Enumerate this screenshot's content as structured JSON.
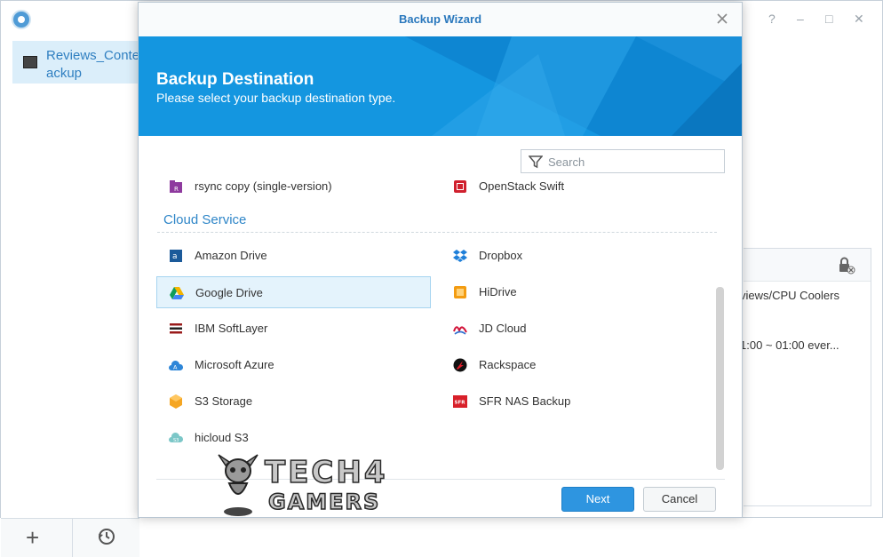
{
  "app": {
    "task_label": "Reviews_Conte\nackup",
    "right_text_1": "views/CPU Coolers",
    "right_text_2": "1:00 ~ 01:00 ever..."
  },
  "modal": {
    "title": "Backup Wizard",
    "heading": "Backup Destination",
    "subheading": "Please select your backup destination type.",
    "search_placeholder": "Search",
    "top_items": [
      {
        "label": "rsync copy (single-version)",
        "icon": "rsync-icon"
      },
      {
        "label": "OpenStack Swift",
        "icon": "openstack-icon"
      }
    ],
    "section_title": "Cloud Service",
    "cloud_left": [
      {
        "label": "Amazon Drive",
        "icon": "amazon-drive-icon"
      },
      {
        "label": "Google Drive",
        "icon": "google-drive-icon",
        "selected": true
      },
      {
        "label": "IBM SoftLayer",
        "icon": "ibm-softlayer-icon"
      },
      {
        "label": "Microsoft Azure",
        "icon": "azure-icon"
      },
      {
        "label": "S3 Storage",
        "icon": "s3-storage-icon"
      },
      {
        "label": "hicloud S3",
        "icon": "hicloud-icon"
      }
    ],
    "cloud_right": [
      {
        "label": "Dropbox",
        "icon": "dropbox-icon"
      },
      {
        "label": "HiDrive",
        "icon": "hidrive-icon"
      },
      {
        "label": "JD Cloud",
        "icon": "jd-cloud-icon"
      },
      {
        "label": "Rackspace",
        "icon": "rackspace-icon"
      },
      {
        "label": "SFR NAS Backup",
        "icon": "sfr-icon"
      }
    ],
    "next_label": "Next",
    "cancel_label": "Cancel"
  },
  "watermark": {
    "line1": "TECH4",
    "line2": "GAMERS"
  },
  "colors": {
    "accent": "#2e95e0",
    "banner": "#1496e0",
    "title": "#2a78bd"
  }
}
